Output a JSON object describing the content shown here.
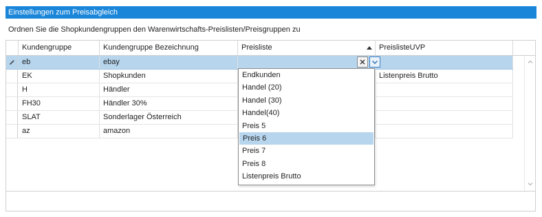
{
  "panel": {
    "title": "Einstellungen zum Preisabgleich",
    "instruction": "Ordnen Sie die Shopkundengruppen den Warenwirtschafts-Preislisten/Preisgruppen zu"
  },
  "grid": {
    "columns": [
      "Kundengruppe",
      "Kundengruppe Bezeichnung",
      "Preisliste",
      "PreislisteUVP"
    ],
    "rows": [
      {
        "kundengruppe": "eb",
        "bezeichnung": "ebay",
        "preisliste": "",
        "uvp": ""
      },
      {
        "kundengruppe": "EK",
        "bezeichnung": "Shopkunden",
        "preisliste": "",
        "uvp": "Listenpreis Brutto"
      },
      {
        "kundengruppe": "H",
        "bezeichnung": "Händler",
        "preisliste": "",
        "uvp": ""
      },
      {
        "kundengruppe": "FH30",
        "bezeichnung": "Händler 30%",
        "preisliste": "",
        "uvp": ""
      },
      {
        "kundengruppe": "SLAT",
        "bezeichnung": "Sonderlager Österreich",
        "preisliste": "",
        "uvp": ""
      },
      {
        "kundengruppe": "az",
        "bezeichnung": "amazon",
        "preisliste": "",
        "uvp": ""
      }
    ],
    "selected_row": 0
  },
  "dropdown": {
    "options": [
      "Endkunden",
      "Handel (20)",
      "Handel (30)",
      "Handel(40)",
      "Preis 5",
      "Preis 6",
      "Preis 7",
      "Preis 8",
      "Listenpreis Brutto"
    ],
    "highlighted_index": 5
  },
  "icons": {
    "row_indicator": "pencil-icon",
    "clear": "close-icon",
    "open_dropdown": "chevron-down-icon",
    "sort": "sort-ascending-icon",
    "scroll_up": "chevron-up-icon",
    "scroll_down": "chevron-down-icon"
  },
  "colors": {
    "title_bar": "#1a86d9",
    "selection": "#b7d6ee"
  }
}
